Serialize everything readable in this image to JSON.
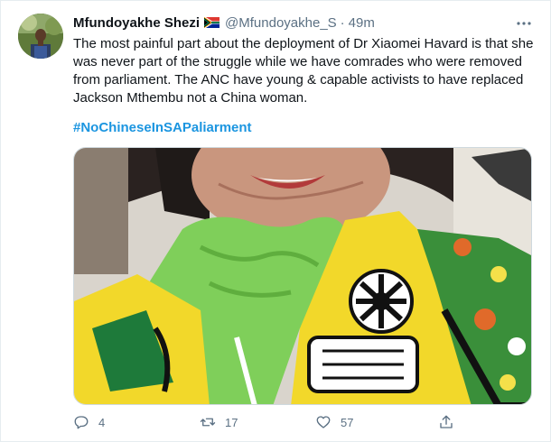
{
  "tweet": {
    "author_name": "Mfundoyakhe Shezi",
    "handle": "@Mfundoyakhe_S",
    "separator": "·",
    "time": "49m",
    "text": "The most painful part about the deployment of Dr Xiaomei Havard is that she was never part of the struggle while we have comrades who were removed from parliament. The ANC have young & capable activists to have replaced Jackson Mthembu not a China woman.",
    "hashtag": "#NoChineseInSAPaliarment",
    "reply_count": "4",
    "retweet_count": "17",
    "like_count": "57"
  },
  "icons": {
    "flag": "south-africa-flag-icon",
    "more": "more-options-icon",
    "reply": "reply-icon",
    "retweet": "retweet-icon",
    "like": "heart-icon",
    "share": "share-icon"
  },
  "colors": {
    "text": "#0f1419",
    "secondary": "#5b7083",
    "hashtag": "#1b95e0",
    "border": "#e6ecf0"
  }
}
